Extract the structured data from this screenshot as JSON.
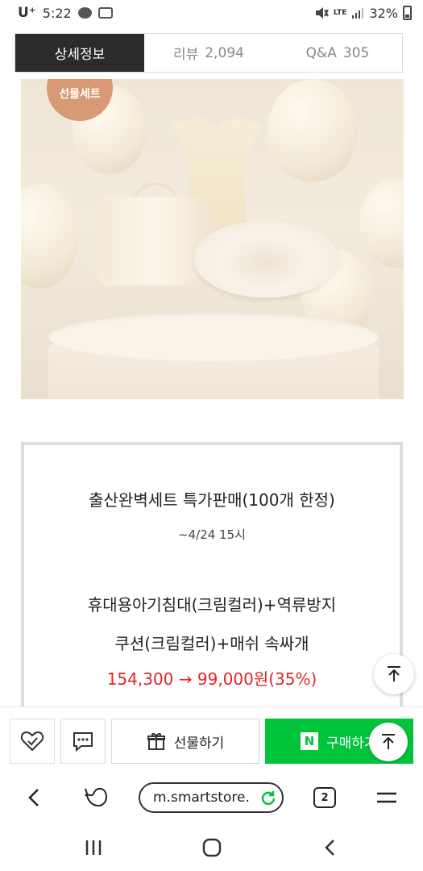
{
  "status_bar": {
    "carrier": "U⁺",
    "time": "5:22",
    "network": "LTE",
    "battery": "32%"
  },
  "tabs": [
    {
      "label": "상세정보",
      "count": ""
    },
    {
      "label": "리뷰",
      "count": "2,094"
    },
    {
      "label": "Q&A",
      "count": "305"
    }
  ],
  "hero": {
    "badge_text": "선물세트"
  },
  "promo": {
    "title": "출산완벽세트 특가판매(100개 한정)",
    "date": "~4/24 15시",
    "line1": "휴대용아기침대(크림컬러)+역류방지",
    "line2": "쿠션(크림컬러)+매쉬 속싸개",
    "price": "154,300 → 99,000원(35%)"
  },
  "actions": {
    "gift_label": "선물하기",
    "buy_label": "구매하기",
    "buy_mark": "N"
  },
  "browser": {
    "url": "m.smartstore.",
    "tab_count": "2"
  },
  "icons": {
    "status": [
      "talk-icon",
      "image-icon",
      "mute-icon",
      "signal-icon",
      "battery-icon"
    ],
    "action_bar": [
      "heart-icon",
      "chat-icon",
      "gift-icon"
    ],
    "browser": [
      "back-icon",
      "whale-browser-icon",
      "reload-icon",
      "menu-icon"
    ],
    "system": [
      "recents-icon",
      "home-icon",
      "system-back-icon"
    ]
  },
  "colors": {
    "accent_green": "#00c43a",
    "price_red": "#e52528",
    "active_tab": "#2b2b2b"
  }
}
